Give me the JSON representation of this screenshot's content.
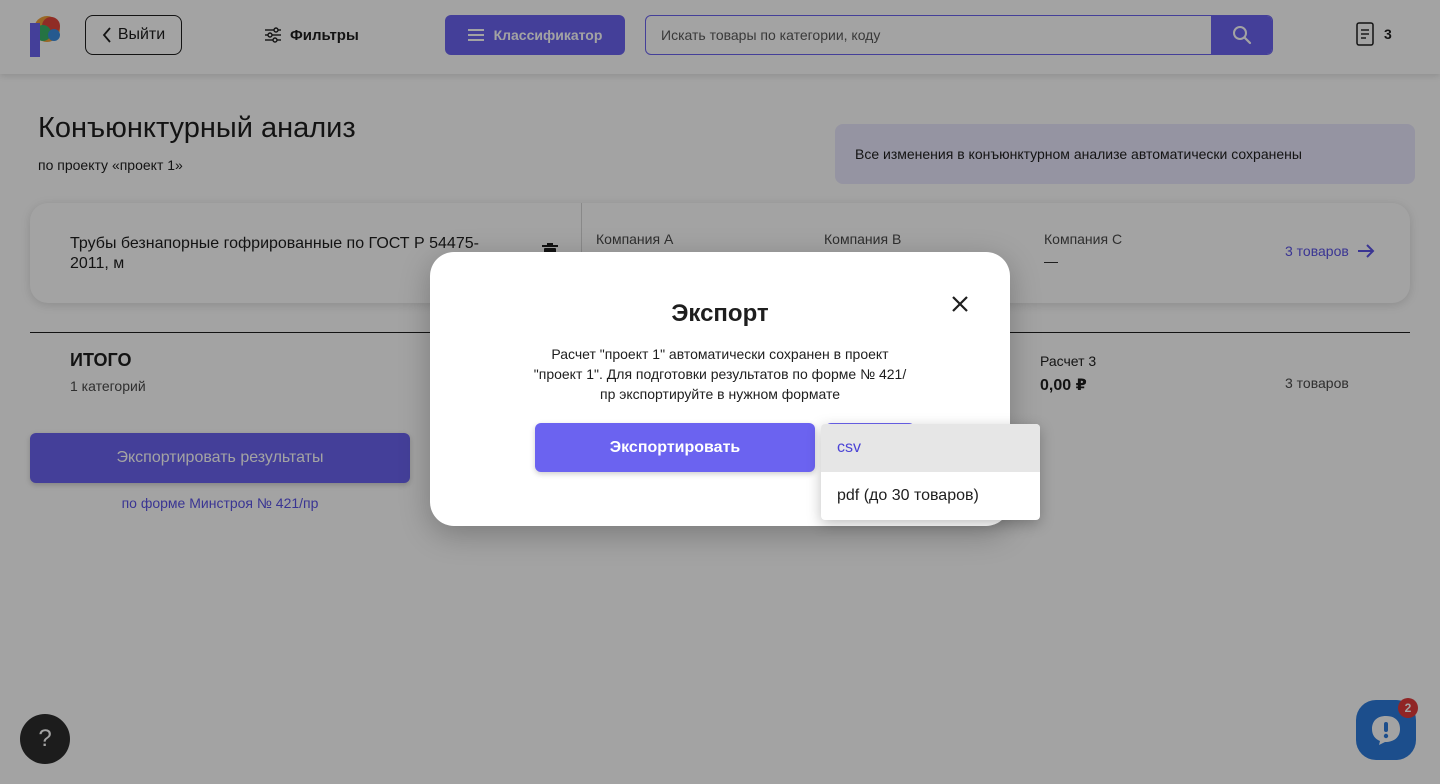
{
  "header": {
    "exit_label": "Выйти",
    "filters_label": "Фильтры",
    "classifier_label": "Классификатор",
    "search_placeholder": "Искать товары по категории, коду",
    "cart_count": "3"
  },
  "page": {
    "title": "Конъюнктурный анализ",
    "subtitle": "по проекту «проект 1»",
    "saved_banner": "Все изменения в конъюнктурном анализе автоматически сохранены"
  },
  "product": {
    "name": "Трубы безнапорные гофрированные по ГОСТ Р 54475-2011, м",
    "companies": [
      {
        "label": "Компания А",
        "value": ""
      },
      {
        "label": "Компания В",
        "value": ""
      },
      {
        "label": "Компания С",
        "value": "—"
      }
    ],
    "goods_link": "3 товаров"
  },
  "totals": {
    "title": "ИТОГО",
    "categories": "1 категорий",
    "calc3_label": "Расчет 3",
    "calc3_value": "0,00 ₽",
    "goods": "3 товаров"
  },
  "export": {
    "button_label": "Экспортировать результаты",
    "note": "по форме Минстроя № 421/пр"
  },
  "help_label": "?",
  "chat_badge": "2",
  "modal": {
    "title": "Экспорт",
    "text": "Расчет \"проект 1\" автоматически сохранен в проект \"проект 1\". Для подготовки результатов по форме № 421/пр экспортируйте в нужном формате",
    "export_label": "Экспортировать",
    "format_options": [
      "csv",
      "pdf (до 30 товаров)"
    ],
    "selected_format": "csv"
  },
  "colors": {
    "accent": "#6b63f0",
    "link": "#5b53e6",
    "chat": "#2d7bdc",
    "badge": "#e23b3b"
  }
}
